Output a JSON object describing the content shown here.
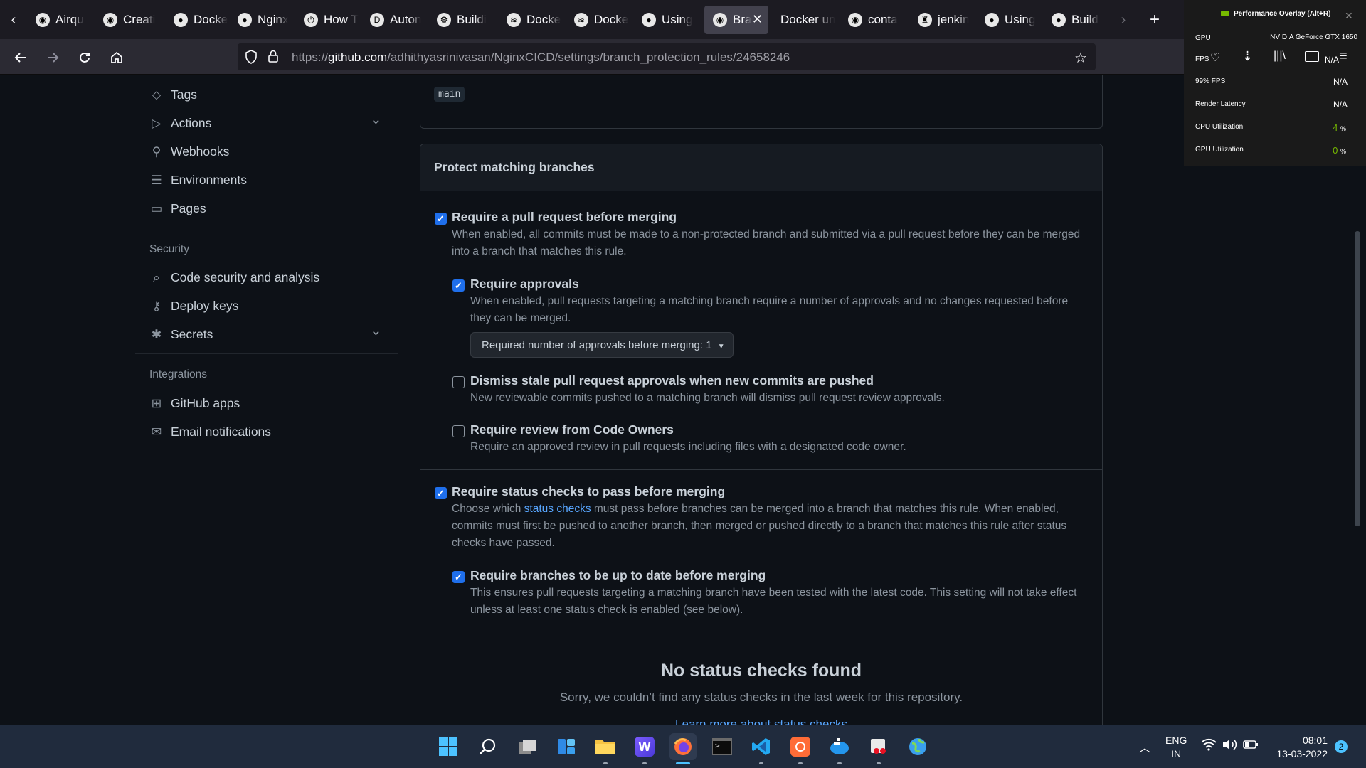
{
  "browser": {
    "tabs": [
      {
        "label": "Airqu",
        "icon": "github-icon"
      },
      {
        "label": "Creati",
        "icon": "github-icon"
      },
      {
        "label": "Docke",
        "icon": "avatar-icon"
      },
      {
        "label": "Nginx",
        "icon": "avatar-icon"
      },
      {
        "label": "How T",
        "icon": "power-icon"
      },
      {
        "label": "Auton",
        "icon": "dev-icon"
      },
      {
        "label": "Buildi",
        "icon": "gear-icon"
      },
      {
        "label": "Docke",
        "icon": "docker-icon"
      },
      {
        "label": "Docke",
        "icon": "docker-icon"
      },
      {
        "label": "Using",
        "icon": "avatar-icon"
      },
      {
        "label": "Bra",
        "icon": "github-icon",
        "active": true
      },
      {
        "label": "Docker un",
        "icon": ""
      },
      {
        "label": "conta",
        "icon": "github-icon"
      },
      {
        "label": "jenkin",
        "icon": "jenkins-icon"
      },
      {
        "label": "Using",
        "icon": "avatar-icon"
      },
      {
        "label": "Build",
        "icon": "avatar-icon"
      }
    ],
    "url_prefix": "https://",
    "url_domain": "github.com",
    "url_path": "/adhithyasrinivasan/NginxCICD/settings/branch_protection_rules/24658246"
  },
  "overlay": {
    "title": "Performance Overlay (Alt+R)",
    "gpu_label": "GPU",
    "gpu_value": "NVIDIA GeForce GTX 1650",
    "fps_label": "FPS",
    "fps_value": "N/A",
    "fps99_label": "99% FPS",
    "fps99_value": "N/A",
    "latency_label": "Render Latency",
    "latency_value": "N/A",
    "cpu_label": "CPU Utilization",
    "cpu_value": "4",
    "cpu_unit": "%",
    "gpu_util_label": "GPU Utilization",
    "gpu_util_value": "0",
    "gpu_util_unit": "%"
  },
  "sidebar": {
    "items_top": [
      {
        "label": "Tags",
        "icon": "tag-icon"
      },
      {
        "label": "Actions",
        "icon": "play-icon",
        "expandable": true
      },
      {
        "label": "Webhooks",
        "icon": "webhook-icon"
      },
      {
        "label": "Environments",
        "icon": "server-icon"
      },
      {
        "label": "Pages",
        "icon": "browser-icon"
      }
    ],
    "security_heading": "Security",
    "security_items": [
      {
        "label": "Code security and analysis",
        "icon": "codescan-icon"
      },
      {
        "label": "Deploy keys",
        "icon": "key-icon"
      },
      {
        "label": "Secrets",
        "icon": "asterisk-icon",
        "expandable": true
      }
    ],
    "integrations_heading": "Integrations",
    "integrations_items": [
      {
        "label": "GitHub apps",
        "icon": "apps-icon"
      },
      {
        "label": "Email notifications",
        "icon": "mail-icon"
      }
    ]
  },
  "main": {
    "branch_pattern": "main",
    "protect_header": "Protect matching branches",
    "require_pr": {
      "label": "Require a pull request before merging",
      "checked": true,
      "desc": "When enabled, all commits must be made to a non-protected branch and submitted via a pull request before they can be merged into a branch that matches this rule."
    },
    "require_approvals": {
      "label": "Require approvals",
      "checked": true,
      "desc": "When enabled, pull requests targeting a matching branch require a number of approvals and no changes requested before they can be merged.",
      "select_label": "Required number of approvals before merging: 1"
    },
    "dismiss_stale": {
      "label": "Dismiss stale pull request approvals when new commits are pushed",
      "checked": false,
      "desc": "New reviewable commits pushed to a matching branch will dismiss pull request review approvals."
    },
    "code_owners": {
      "label": "Require review from Code Owners",
      "checked": false,
      "desc": "Require an approved review in pull requests including files with a designated code owner."
    },
    "status_checks": {
      "label": "Require status checks to pass before merging",
      "checked": true,
      "desc_before": "Choose which ",
      "desc_link": "status checks",
      "desc_after": " must pass before branches can be merged into a branch that matches this rule. When enabled, commits must first be pushed to another branch, then merged or pushed directly to a branch that matches this rule after status checks have passed."
    },
    "up_to_date": {
      "label": "Require branches to be up to date before merging",
      "checked": true,
      "desc": "This ensures pull requests targeting a matching branch have been tested with the latest code. This setting will not take effect unless at least one status check is enabled (see below)."
    },
    "no_checks_title": "No status checks found",
    "no_checks_desc": "Sorry, we couldn’t find any status checks in the last week for this repository.",
    "learn_more": "Learn more about status checks"
  },
  "taskbar": {
    "lang": "ENG",
    "region": "IN",
    "time": "08:01",
    "date": "13-03-2022",
    "notifications": "2"
  }
}
